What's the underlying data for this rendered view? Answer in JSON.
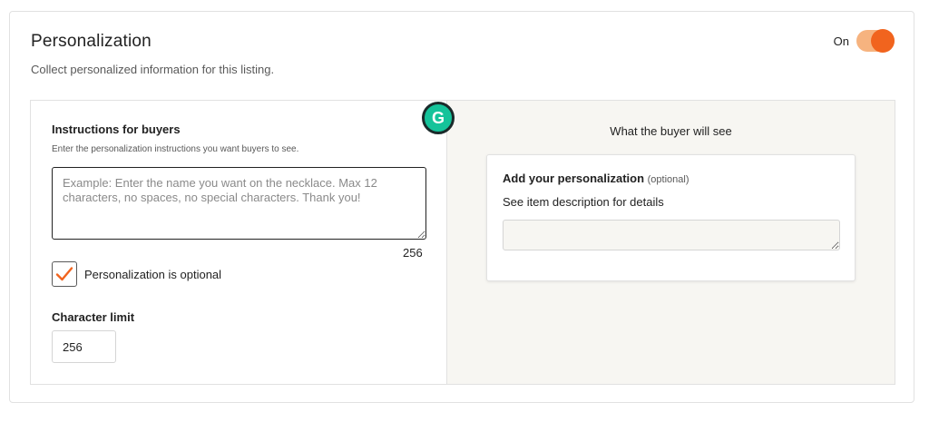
{
  "section": {
    "title": "Personalization",
    "subtitle": "Collect personalized information for this listing.",
    "toggle_label": "On",
    "toggle_state": "on",
    "accent_color": "#f1641e"
  },
  "instructions": {
    "heading": "Instructions for buyers",
    "help_text": "Enter the personalization instructions you want buyers to see.",
    "value": "",
    "placeholder": "Example: Enter the name you want on the necklace. Max 12 characters, no spaces, no special characters. Thank you!",
    "char_count": "256"
  },
  "optional_checkbox": {
    "label": "Personalization is optional",
    "checked": true
  },
  "character_limit": {
    "heading": "Character limit",
    "value": "256"
  },
  "grammarly": {
    "glyph": "G",
    "icon": "grammarly-icon"
  },
  "preview": {
    "heading": "What the buyer will see",
    "title": "Add your personalization",
    "optional_tag": "(optional)",
    "description": "See item description for details",
    "input_value": ""
  }
}
